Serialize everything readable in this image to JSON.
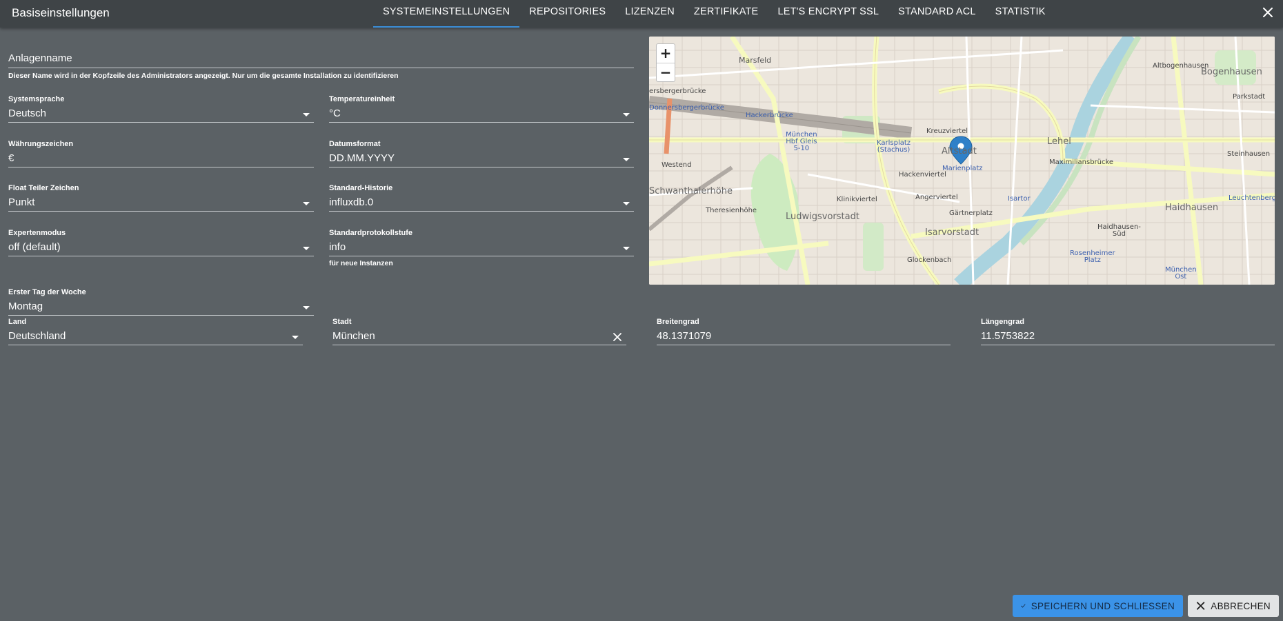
{
  "dialog": {
    "title": "Basiseinstellungen"
  },
  "tabs": [
    {
      "label": "SYSTEMEINSTELLUNGEN",
      "active": true
    },
    {
      "label": "REPOSITORIES"
    },
    {
      "label": "LIZENZEN"
    },
    {
      "label": "ZERTIFIKATE"
    },
    {
      "label": "LET'S ENCRYPT SSL"
    },
    {
      "label": "STANDARD ACL"
    },
    {
      "label": "STATISTIK"
    }
  ],
  "form": {
    "system_name": {
      "label": "Anlagenname",
      "value": "",
      "helper": "Dieser Name wird in der Kopfzeile des Administrators angezeigt. Nur um die gesamte Installation zu identifizieren"
    },
    "language": {
      "label": "Systemsprache",
      "value": "Deutsch"
    },
    "temperature": {
      "label": "Temperatureinheit",
      "value": "°C"
    },
    "currency": {
      "label": "Währungszeichen",
      "value": "€"
    },
    "date_format": {
      "label": "Datumsformat",
      "value": "DD.MM.YYYY"
    },
    "float_separator": {
      "label": "Float Teiler Zeichen",
      "value": "Punkt"
    },
    "default_history": {
      "label": "Standard-Historie",
      "value": "influxdb.0"
    },
    "expert_mode": {
      "label": "Expertenmodus",
      "value": "off (default)"
    },
    "log_level": {
      "label": "Standardprotokollstufe",
      "value": "info",
      "helper": "für neue Instanzen"
    },
    "first_day": {
      "label": "Erster Tag der Woche",
      "value": "Montag"
    },
    "country": {
      "label": "Land",
      "value": "Deutschland"
    },
    "city": {
      "label": "Stadt",
      "value": "München"
    },
    "latitude": {
      "label": "Breitengrad",
      "value": "48.1371079"
    },
    "longitude": {
      "label": "Längengrad",
      "value": "11.5753822"
    }
  },
  "map": {
    "zoom_in": "+",
    "zoom_out": "−",
    "labels": {
      "maxvorstadt": "Marsfeld",
      "altbogenhausen": "Altbogenhausen",
      "bogenhausen": "Bogenhausen",
      "hackerbruecke": "Hackerbrücke",
      "hackerbruecke2": "Hackerbrücke",
      "hbf": "München\nHbf Gleis\n5-10",
      "karlsplatz": "Karlsplatz\n(Stachus)",
      "kreuzviertel": "Kreuzviertel",
      "altstadt": "Altstadt",
      "lehel": "Lehel",
      "marienplatz": "Marienplatz",
      "westend": "Westend",
      "schwanthalerhoehe": "Schwanthalerhöhe",
      "theresienhoehe": "Theresienhöhe",
      "klinikviertel": "Klinikviertel",
      "ludwigsvorstadt": "Ludwigsvorstadt",
      "hackenviertel": "Hackenviertel",
      "angerviertel": "Angerviertel",
      "gaertnerplatz": "Gärtnerplatz",
      "isartor": "Isartor",
      "isarvorstadt": "Isarvorstadt",
      "glockenbach": "Glockenbach",
      "maximiliansbruecke": "Maximiliansbrücke",
      "steinhausen": "Steinhausen",
      "parkstadt": "Parkstadt",
      "haidhausen": "Haidhausen",
      "haidhausen_sued": "Haidhausen-\nSüd",
      "rosenheimer": "Rosenheimer\nPlatz",
      "muenchen_ost": "München\nOst",
      "leuchtenberg": "Leuchtenbergr",
      "donnersberger": "Donnersbergerbrücke",
      "bergerbruecke": "ersbergerbrücke"
    }
  },
  "actions": {
    "save_label": "SPEICHERN UND SCHLIESSEN",
    "cancel_label": "ABBRECHEN"
  },
  "colors": {
    "background": "#5b6165",
    "topbar": "#3f4447",
    "accent": "#3b93e8",
    "tab_indicator": "#3b8ed8"
  }
}
